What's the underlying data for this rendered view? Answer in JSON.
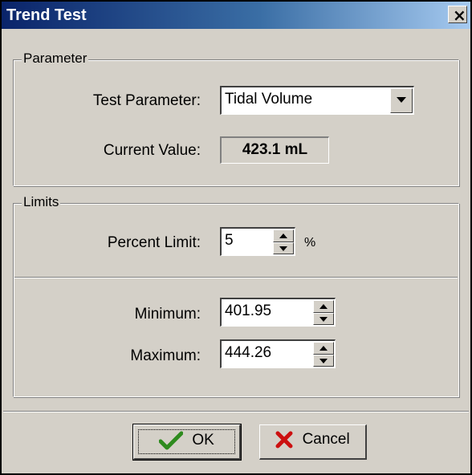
{
  "window": {
    "title": "Trend Test",
    "close_glyph": "×"
  },
  "parameter_group": {
    "legend": "Parameter",
    "test_parameter_label": "Test Parameter:",
    "test_parameter_value": "Tidal Volume",
    "current_value_label": "Current Value:",
    "current_value": "423.1  mL"
  },
  "limits_group": {
    "legend": "Limits",
    "percent_limit_label": "Percent Limit:",
    "percent_limit_value": "5",
    "percent_unit": "%",
    "minimum_label": "Minimum:",
    "minimum_value": "401.95",
    "maximum_label": "Maximum:",
    "maximum_value": "444.26"
  },
  "buttons": {
    "ok_label": "OK",
    "cancel_label": "Cancel"
  },
  "icons": {
    "ok": "checkmark-icon",
    "cancel": "x-mark-icon",
    "dropdown": "chevron-down-icon"
  },
  "colors": {
    "titlebar_start": "#0a246a",
    "titlebar_end": "#a6caf0",
    "dialog_bg": "#d4d0c8",
    "ok_check": "#2e8b1e",
    "cancel_x": "#cc1010"
  }
}
